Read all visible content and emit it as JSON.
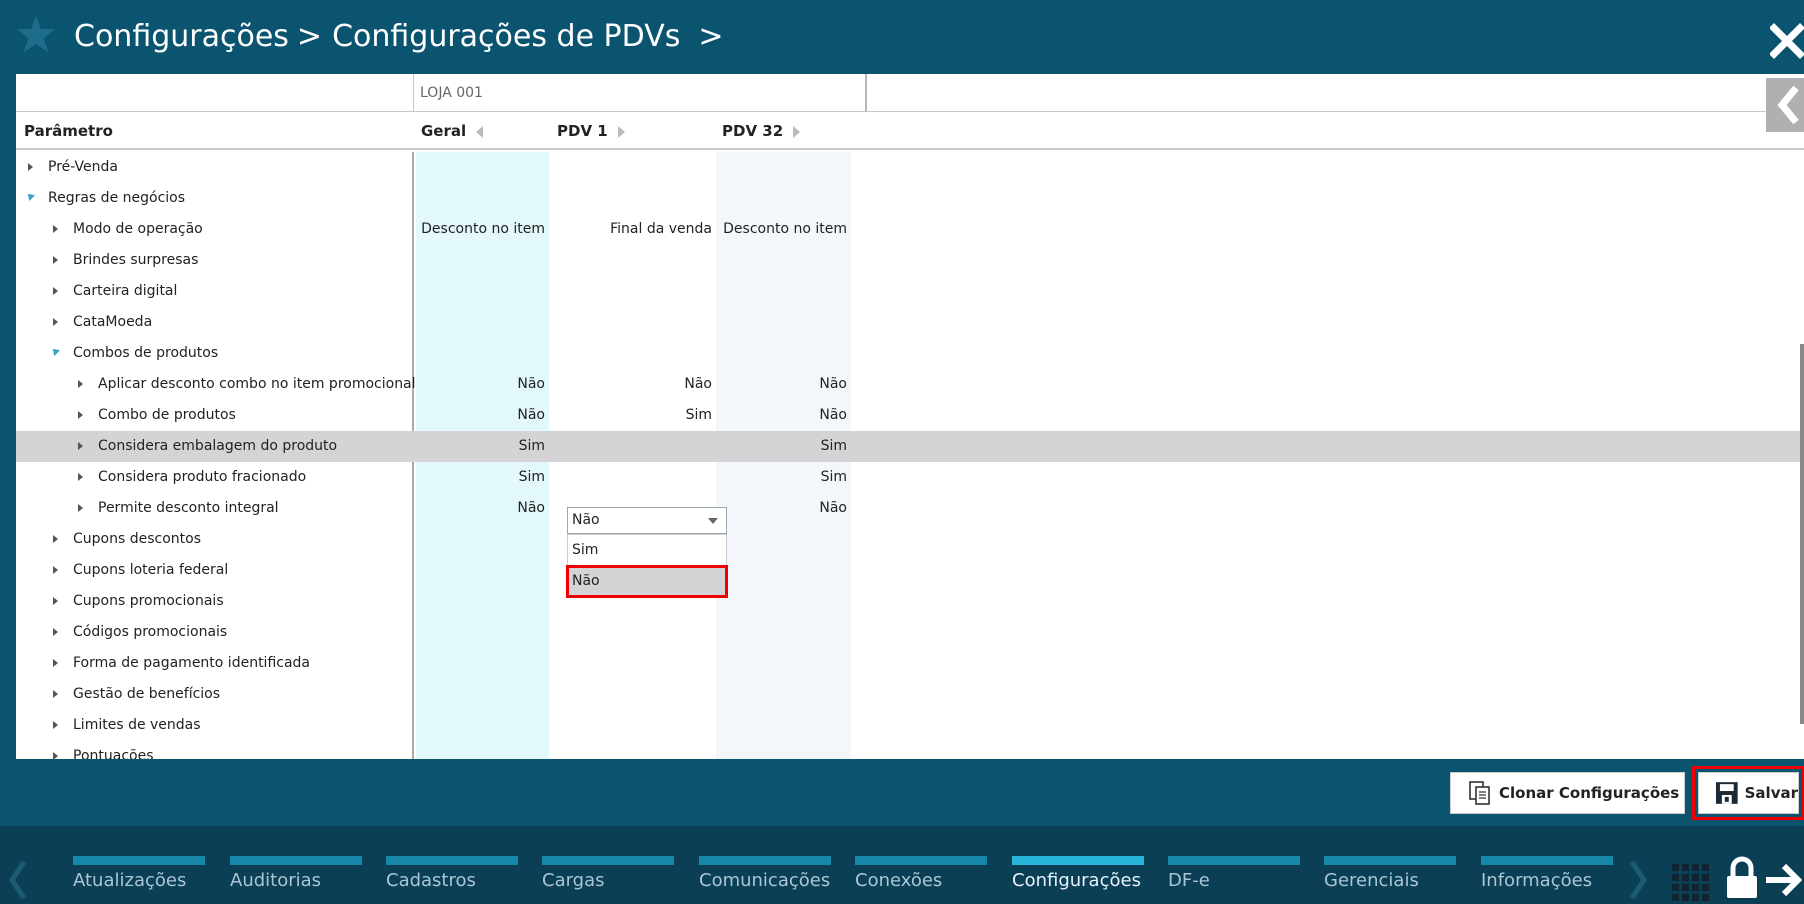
{
  "header": {
    "breadcrumb_1": "Configurações",
    "breadcrumb_2": "Configurações de PDVs",
    "separator": ">"
  },
  "grid": {
    "store_label": "LOJA 001",
    "param_header": "Parâmetro",
    "columns": [
      "Geral",
      "PDV 1",
      "PDV 32"
    ],
    "rows": [
      {
        "label": "Pré-Venda",
        "geral": "",
        "pdv1": "",
        "pdv32": ""
      },
      {
        "label": "Regras de negócios",
        "geral": "",
        "pdv1": "",
        "pdv32": ""
      },
      {
        "label": "Modo de operação",
        "geral": "Desconto no item",
        "pdv1": "Final da venda",
        "pdv32": "Desconto no item"
      },
      {
        "label": "Brindes surpresas",
        "geral": "",
        "pdv1": "",
        "pdv32": ""
      },
      {
        "label": "Carteira digital",
        "geral": "",
        "pdv1": "",
        "pdv32": ""
      },
      {
        "label": "CataMoeda",
        "geral": "",
        "pdv1": "",
        "pdv32": ""
      },
      {
        "label": "Combos de produtos",
        "geral": "",
        "pdv1": "",
        "pdv32": ""
      },
      {
        "label": "Aplicar desconto combo no item promocional",
        "geral": "Não",
        "pdv1": "Não",
        "pdv32": "Não"
      },
      {
        "label": "Combo de produtos",
        "geral": "Não",
        "pdv1": "Sim",
        "pdv32": "Não"
      },
      {
        "label": "Considera embalagem do produto",
        "geral": "Sim",
        "pdv1": "",
        "pdv32": "Sim"
      },
      {
        "label": "Considera produto fracionado",
        "geral": "Sim",
        "pdv1": "",
        "pdv32": "Sim"
      },
      {
        "label": "Permite desconto integral",
        "geral": "Não",
        "pdv1": "",
        "pdv32": "Não"
      },
      {
        "label": "Cupons descontos",
        "geral": "",
        "pdv1": "",
        "pdv32": ""
      },
      {
        "label": "Cupons loteria federal",
        "geral": "",
        "pdv1": "",
        "pdv32": ""
      },
      {
        "label": "Cupons promocionais",
        "geral": "",
        "pdv1": "",
        "pdv32": ""
      },
      {
        "label": "Códigos promocionais",
        "geral": "",
        "pdv1": "",
        "pdv32": ""
      },
      {
        "label": "Forma de pagamento identificada",
        "geral": "",
        "pdv1": "",
        "pdv32": ""
      },
      {
        "label": "Gestão de benefícios",
        "geral": "",
        "pdv1": "",
        "pdv32": ""
      },
      {
        "label": "Limites de vendas",
        "geral": "",
        "pdv1": "",
        "pdv32": ""
      },
      {
        "label": "Pontuações",
        "geral": "",
        "pdv1": "",
        "pdv32": ""
      }
    ]
  },
  "dropdown": {
    "value": "Não",
    "options": [
      "Sim",
      "Não"
    ]
  },
  "actions": {
    "clone_label": "Clonar Configurações",
    "save_label": "Salvar"
  },
  "nav": {
    "items": [
      "Atualizações",
      "Auditorias",
      "Cadastros",
      "Cargas",
      "Comunicações",
      "Conexões",
      "Configurações",
      "DF-e",
      "Gerenciais",
      "Informações"
    ],
    "active": "Configurações"
  },
  "colors": {
    "header_bg": "#0b5470",
    "nav_bg": "#0a3f56",
    "nav_bar": "#1687a8",
    "nav_bar_active": "#26b5d8",
    "highlight_red": "#e00000"
  }
}
